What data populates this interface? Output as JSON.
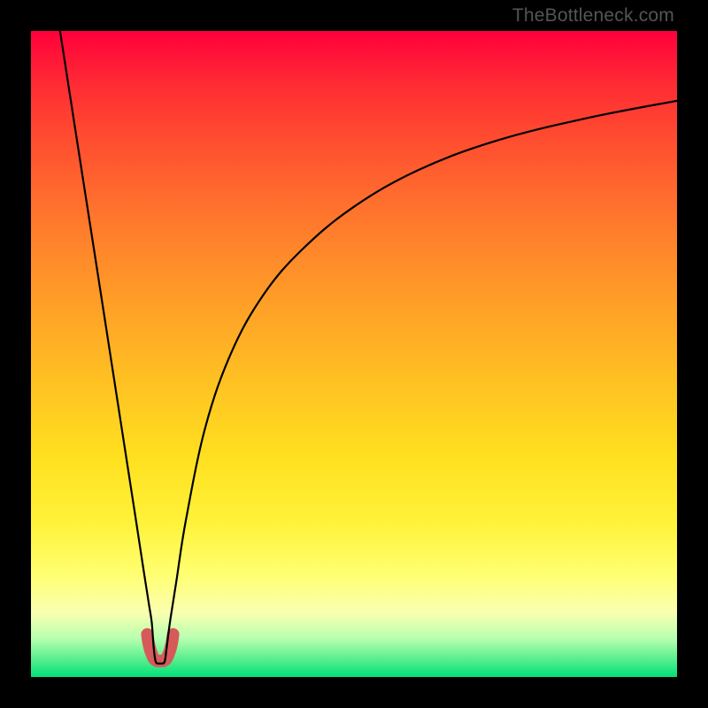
{
  "watermark": "TheBottleneck.com",
  "chart_data": {
    "type": "line",
    "title": "",
    "xlabel": "",
    "ylabel": "",
    "xlim": [
      0,
      100
    ],
    "ylim": [
      0,
      100
    ],
    "vertex_x_pct": 20,
    "series": [
      {
        "name": "bottleneck-curve",
        "x": [
          4.5,
          6.0,
          8.0,
          10.0,
          12.0,
          14.0,
          16.0,
          17.5,
          18.3,
          18.7,
          19.0,
          19.3,
          19.7,
          20.0,
          20.3,
          20.7,
          21.0,
          21.5,
          22.5,
          24.0,
          27.0,
          31.0,
          36.0,
          42.0,
          50.0,
          60.0,
          72.0,
          86.0,
          100.0
        ],
        "y_pct": [
          100.0,
          90.3,
          77.4,
          64.6,
          51.7,
          38.8,
          25.9,
          16.1,
          11.0,
          8.4,
          4.5,
          2.4,
          2.1,
          2.1,
          2.1,
          2.4,
          4.5,
          8.4,
          14.8,
          24.4,
          38.7,
          50.2,
          59.2,
          66.2,
          72.8,
          78.5,
          83.0,
          86.5,
          89.2
        ]
      },
      {
        "name": "vertex-marker",
        "x": [
          18.0,
          18.2,
          18.5,
          19.0,
          19.5,
          20.0,
          20.5,
          21.0,
          21.5,
          21.8,
          22.0
        ],
        "y_pct": [
          6.6,
          5.3,
          4.1,
          2.9,
          2.5,
          2.5,
          2.5,
          2.9,
          4.1,
          5.3,
          6.6
        ]
      }
    ],
    "colors": {
      "curve": "#000000",
      "marker": "#d65a5a",
      "background_top": "#ff003a",
      "background_bottom": "#00e07a"
    }
  }
}
